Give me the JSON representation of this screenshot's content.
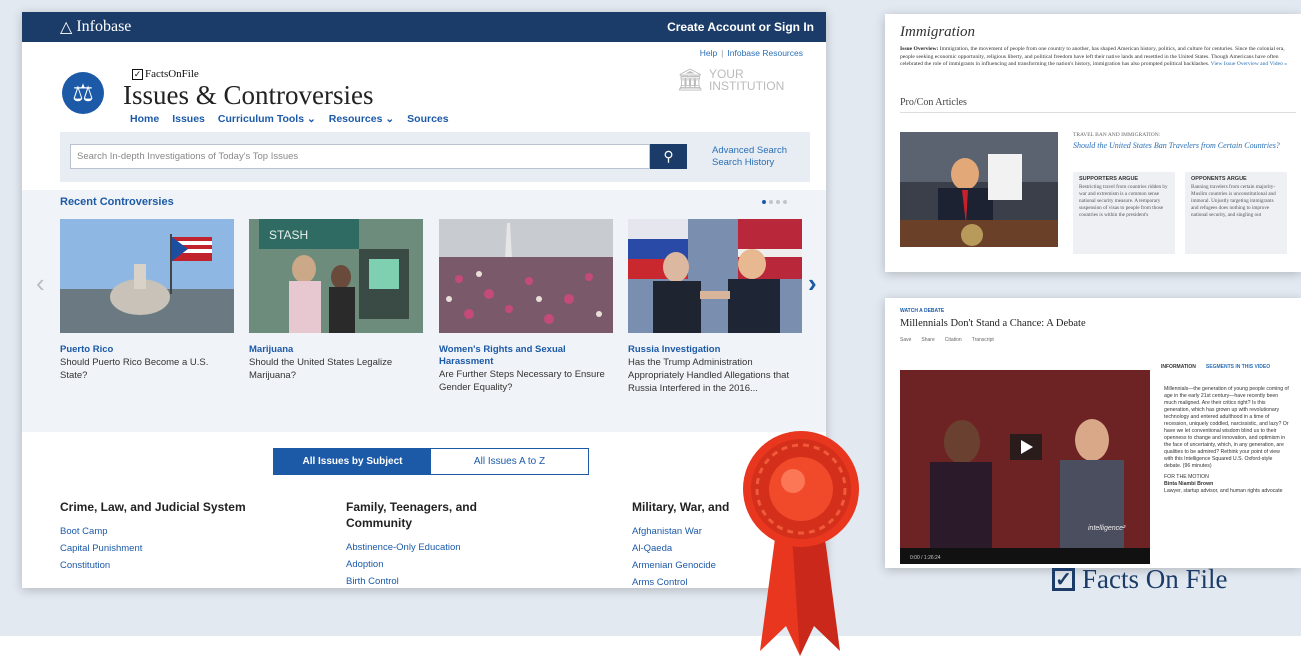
{
  "main": {
    "logo": "Infobase",
    "signin": "Create Account or Sign In",
    "help": "Help",
    "resources_link": "Infobase Resources",
    "brand_small": "FactsOnFile",
    "site_title": "Issues & Controversies",
    "nav": [
      "Home",
      "Issues",
      "Curriculum Tools ⌄",
      "Resources ⌄",
      "Sources"
    ],
    "institution": [
      "YOUR",
      "INSTITUTION"
    ],
    "search_placeholder": "Search In-depth Investigations of Today's Top Issues",
    "advanced_search": "Advanced Search",
    "search_history": "Search History",
    "recent_label": "Recent Controversies",
    "cards": [
      {
        "title": "Puerto Rico",
        "sub": "Should Puerto Rico Become a U.S. State?"
      },
      {
        "title": "Marijuana",
        "sub": "Should the United States Legalize Marijuana?"
      },
      {
        "title": "Women's Rights and Sexual Harassment",
        "sub": "Are Further Steps Necessary to Ensure Gender Equality?"
      },
      {
        "title": "Russia Investigation",
        "sub": "Has the Trump Administration Appropriately Handled Allegations that Russia Interfered in the 2016..."
      }
    ],
    "tab_subject": "All Issues by Subject",
    "tab_az": "All Issues A to Z",
    "columns": [
      {
        "head": "Crime, Law, and Judicial System",
        "items": [
          "Boot Camp",
          "Capital Punishment",
          "Constitution"
        ]
      },
      {
        "head": "Family, Teenagers, and Community",
        "items": [
          "Abstinence-Only Education",
          "Adoption",
          "Birth Control"
        ]
      },
      {
        "head": "Military, War, and",
        "items": [
          "Afghanistan War",
          "Al-Qaeda",
          "Armenian Genocide",
          "Arms Control"
        ]
      }
    ]
  },
  "immigration": {
    "title": "Immigration",
    "overview_label": "Issue Overview:",
    "overview_text": "Immigration, the movement of people from one country to another, has shaped American history, politics, and culture for centuries. Since the colonial era, people seeking economic opportunity, religious liberty, and political freedom have left their native lands and resettled in the United States. Though Americans have often celebrated the role of immigrants in influencing and transforming the nation's history, immigration has also prompted political backlashes.",
    "overview_link": "View Issue Overview and Video »",
    "procon": "Pro/Con Articles",
    "tag": "TRAVEL BAN AND IMMIGRATION:",
    "question": "Should the United States Ban Travelers from Certain Countries?",
    "supporters_head": "SUPPORTERS ARGUE",
    "supporters_text": "Restricting travel from countries ridden by war and extremism is a common sense national security measure. A temporary suspension of visas to people from those countries is within the president's",
    "opponents_head": "OPPONENTS ARGUE",
    "opponents_text": "Banning travelers from certain majority-Muslim countries is unconstitutional and immoral. Unjustly targeting immigrants and refugees does nothing to improve national security, and singling out"
  },
  "video": {
    "kicker": "WATCH A DEBATE",
    "title": "Millennials Don't Stand a Chance: A Debate",
    "tools": [
      "Save",
      "Share",
      "Citation",
      "Transcript"
    ],
    "tab_info": "INFORMATION",
    "tab_segments": "SEGMENTS IN THIS VIDEO",
    "description": "Millennials—the generation of young people coming of age in the early 21st century—have recently been much maligned. Are their critics right? Is this generation, which has grown up with revolutionary technology and entered adulthood in a time of recession, uniquely coddled, narcissistic, and lazy? Or have we let conventional wisdom blind us to their openness to change and innovation, and optimism in the face of uncertainty, which, in any generation, are qualities to be admired? Rethink your point of view with this Intelligence Squared U.S. Oxford-style debate. (96 minutes)",
    "motion": "FOR THE MOTION",
    "speaker": "Binta Niambi Brown",
    "speaker_role": "Lawyer, startup advisor, and human rights advocate",
    "time": "0:00 / 1:26:24",
    "overlay": "intelligence²"
  },
  "brand_large": "Facts On File",
  "colors": {
    "navy": "#1b3c68",
    "link": "#1c5aa8",
    "ribbon": "#e8361f"
  }
}
